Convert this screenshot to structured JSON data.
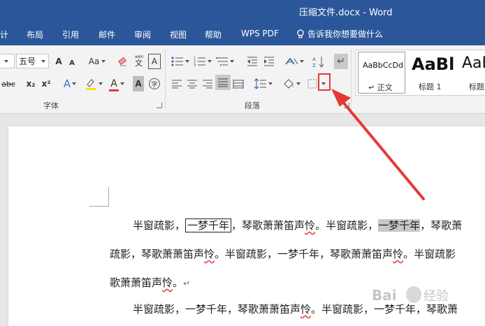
{
  "app": {
    "title": "压缩文件.docx - Word"
  },
  "tabs": [
    "计",
    "布局",
    "引用",
    "邮件",
    "审阅",
    "视图",
    "帮助",
    "WPS PDF"
  ],
  "tell_me": "告诉我你想要做什么",
  "font_group": {
    "label": "字体",
    "font_size": "五号",
    "font_name_tail": "",
    "buttons": [
      "A",
      "A",
      "Aa",
      "A",
      "abc",
      "x₂",
      "x²",
      "A",
      "A",
      "A",
      "字"
    ]
  },
  "paragraph_group": {
    "label": "段落"
  },
  "styles_gallery": [
    {
      "sample": "AaBbCcDd",
      "name": "↵ 正文"
    },
    {
      "sample": "AaBl",
      "name": "标题 1"
    },
    {
      "sample": "AaB",
      "name": "标题"
    }
  ],
  "document": {
    "line1": {
      "a": "半窗疏影，",
      "boxed": "一梦千年",
      "b": "，琴歌萧萧笛声",
      "w1": "怜",
      "c": "。半窗疏影，",
      "shaded": "一梦千年",
      "d": "，琴歌萧"
    },
    "line2": {
      "a": "疏影，琴歌萧萧笛声",
      "w1": "怜",
      "b": "。半窗疏影，一梦千年，琴歌萧萧笛声",
      "w2": "怜",
      "c": "。半窗疏影"
    },
    "line3": {
      "a": "歌萧萧笛声",
      "w1": "怜",
      "b": "。",
      "mark": "↵"
    },
    "line4": {
      "a": "半窗疏影，一梦千年，琴歌萧萧笛声",
      "w1": "怜",
      "b": "。半窗疏影，一梦千年，琴歌萧"
    }
  },
  "watermark": "Baidu 经验"
}
